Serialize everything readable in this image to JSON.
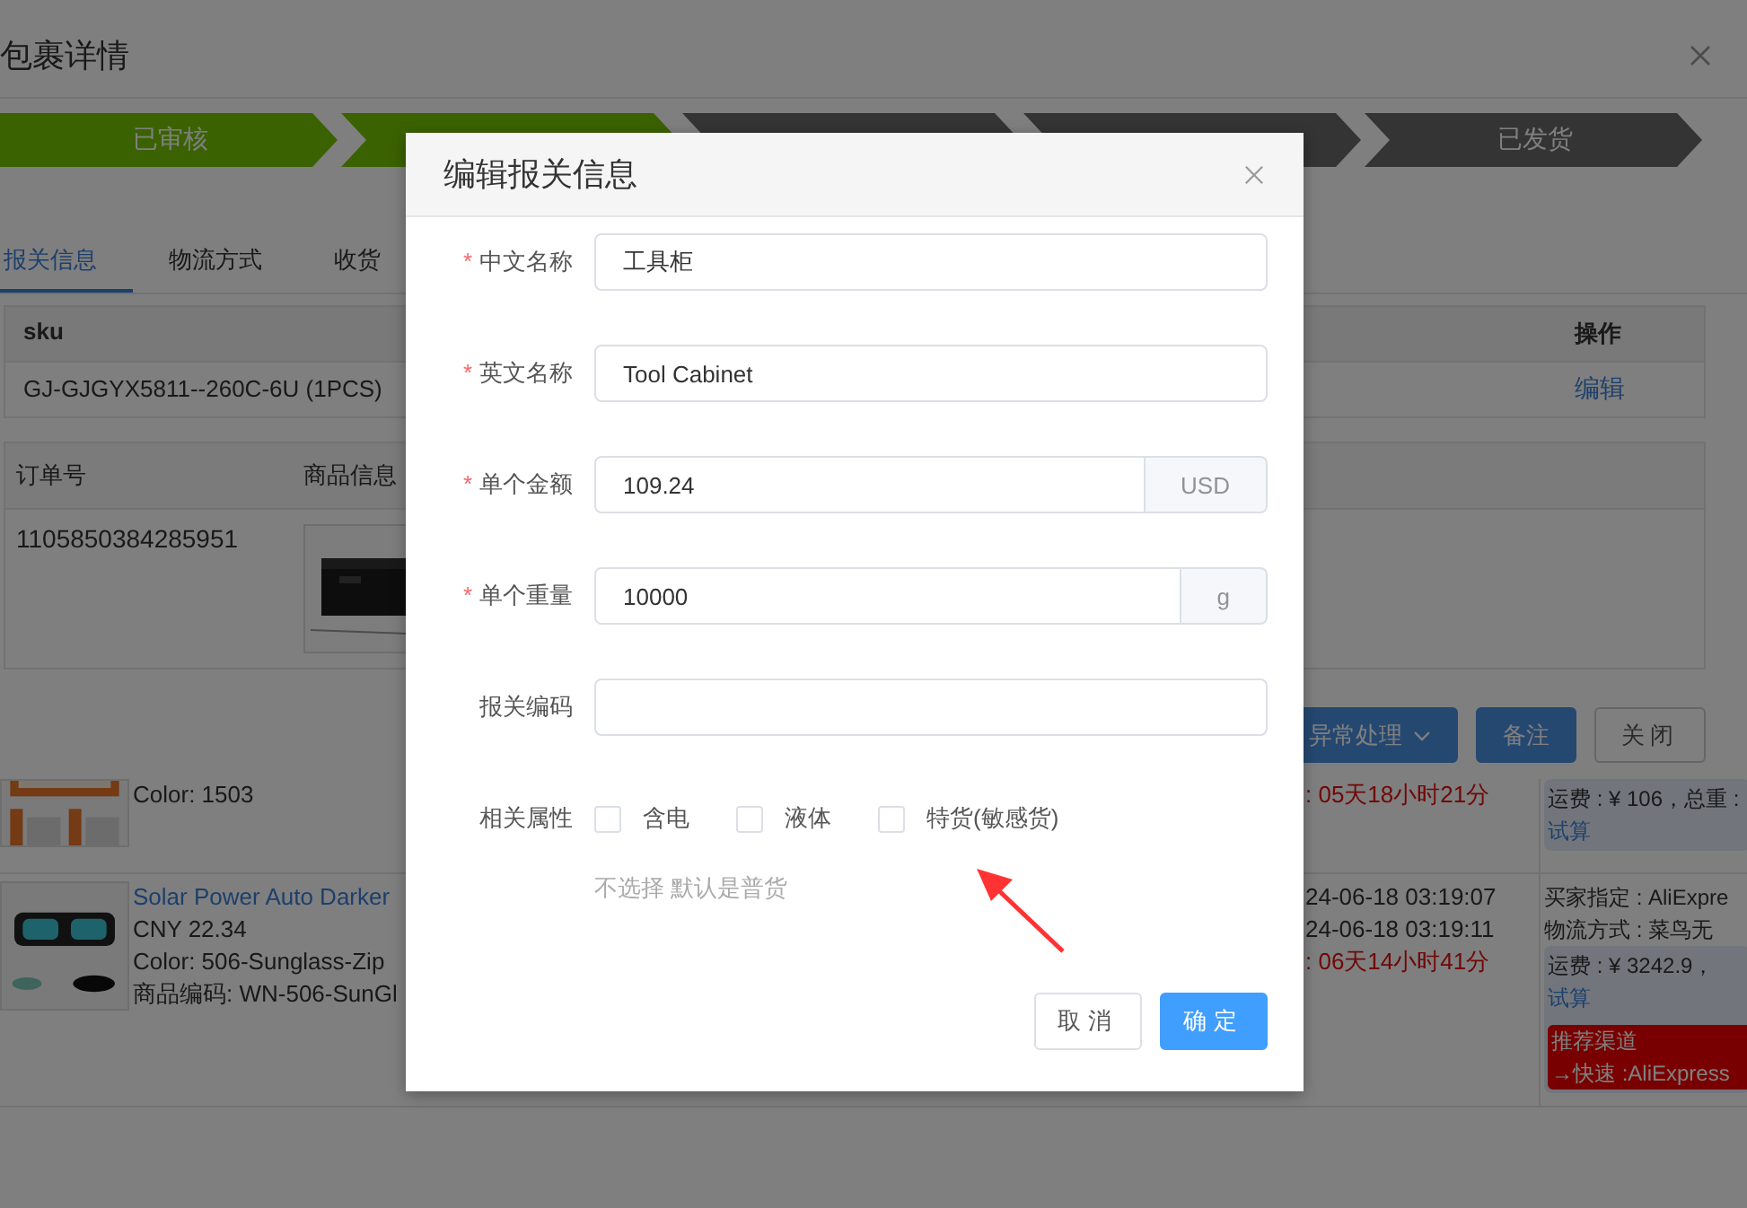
{
  "orders": [
    {
      "product_lines": [
        {
          "text": "Color: 1503",
          "kind": "plain"
        }
      ],
      "time_lines": [
        {
          "text": ": 05天18小时21分",
          "kind": "countdown"
        }
      ],
      "freight": {
        "text": "运费 : ¥ 106，总重 :",
        "link": "试算"
      }
    },
    {
      "product_lines": [
        {
          "text": "Solar Power Auto Darker",
          "kind": "link"
        },
        {
          "text": "CNY 22.34",
          "kind": "plain"
        },
        {
          "text": "Color: 506-Sunglass-Zip",
          "kind": "plain"
        },
        {
          "text": "商品编码: WN-506-SunGl",
          "kind": "plain"
        }
      ],
      "time_lines": [
        {
          "text": "24-06-18 03:19:07",
          "kind": "date"
        },
        {
          "text": "24-06-18 03:19:11",
          "kind": "date"
        },
        {
          "text": ": 06天14小时41分",
          "kind": "countdown"
        }
      ],
      "logistics_lines": [
        "买家指定 : AliExpre",
        "物流方式 : 菜鸟无"
      ],
      "freight": {
        "text": "运费 : ¥ 3242.9，",
        "link": "试算"
      },
      "recommend": [
        "推荐渠道",
        "→快速 :AliExpress"
      ]
    }
  ],
  "detail_dialog": {
    "title": "包裹详情",
    "steps": [
      {
        "label": "已审核",
        "done": true
      },
      {
        "done": true
      },
      {
        "done": false
      },
      {
        "done": false
      },
      {
        "label": "已发货",
        "done": false
      }
    ],
    "tabs": [
      {
        "label": "报关信息",
        "selected": true
      },
      {
        "label": "物流方式",
        "selected": false
      },
      {
        "label": "收货",
        "selected": false
      }
    ],
    "sku_table": {
      "columns": [
        "sku",
        "操作"
      ],
      "rows": [
        {
          "sku": "GJ-GJGYX5811--260C-6U (1PCS)",
          "action": "编辑"
        }
      ]
    },
    "order_table": {
      "columns": [
        "订单号",
        "商品信息"
      ],
      "rows": [
        {
          "order_no": "1105850384285951"
        }
      ]
    },
    "buttons": [
      {
        "label": "异常处理",
        "kind": "dropdown"
      },
      {
        "label": "备注",
        "kind": "primary"
      },
      {
        "label": "关闭",
        "kind": "default"
      }
    ]
  },
  "edit_dialog": {
    "title": "编辑报关信息",
    "fields": [
      {
        "label": "中文名称",
        "required_mark": "*",
        "value": "工具柜"
      },
      {
        "label": "英文名称",
        "required_mark": "*",
        "value": "Tool Cabinet"
      },
      {
        "label": "单个金额",
        "required_mark": "*",
        "value": "109.24",
        "append": "USD"
      },
      {
        "label": "单个重量",
        "required_mark": "*",
        "value": "10000",
        "append": "g"
      },
      {
        "label": "报关编码"
      }
    ],
    "attributes": {
      "label": "相关属性",
      "options": [
        {
          "label": "含电",
          "checked": false
        },
        {
          "label": "液体",
          "checked": false
        },
        {
          "label": "特货(敏感货)",
          "checked": false
        }
      ],
      "hint": "不选择 默认是普货"
    },
    "buttons": [
      {
        "label": "取消",
        "kind": "default"
      },
      {
        "label": "确定",
        "kind": "primary"
      }
    ]
  }
}
